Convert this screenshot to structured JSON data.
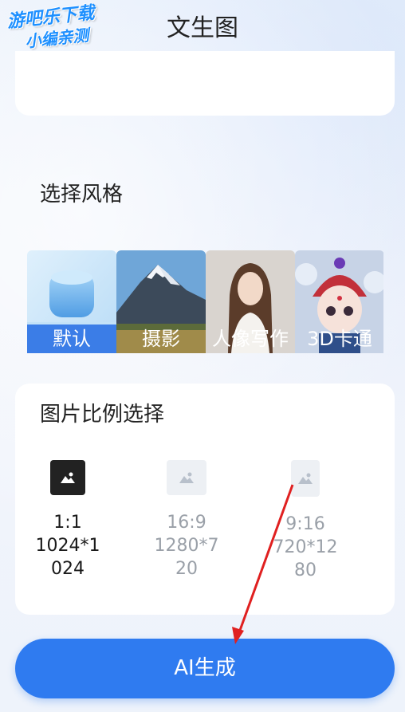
{
  "watermark": {
    "line1": "游吧乐下载",
    "line2": "小编亲测"
  },
  "page_title": "文生图",
  "style_section": {
    "title": "选择风格",
    "items": [
      {
        "label": "默认",
        "active": true
      },
      {
        "label": "摄影",
        "active": false
      },
      {
        "label": "人像写作",
        "active": false
      },
      {
        "label": "3D卡通",
        "active": false
      }
    ]
  },
  "ratio_section": {
    "title": "图片比例选择",
    "items": [
      {
        "ratio": "1:1",
        "size_line1": "1024*1",
        "size_line2": "024",
        "selected": true
      },
      {
        "ratio": "16:9",
        "size_line1": "1280*7",
        "size_line2": "20",
        "selected": false
      },
      {
        "ratio": "9:16",
        "size_line1": "720*12",
        "size_line2": "80",
        "selected": false
      }
    ]
  },
  "generate_button": {
    "label": "AI生成"
  },
  "colors": {
    "accent": "#2f7bf0",
    "style_active": "#3b7de7",
    "arrow": "#e02020"
  }
}
